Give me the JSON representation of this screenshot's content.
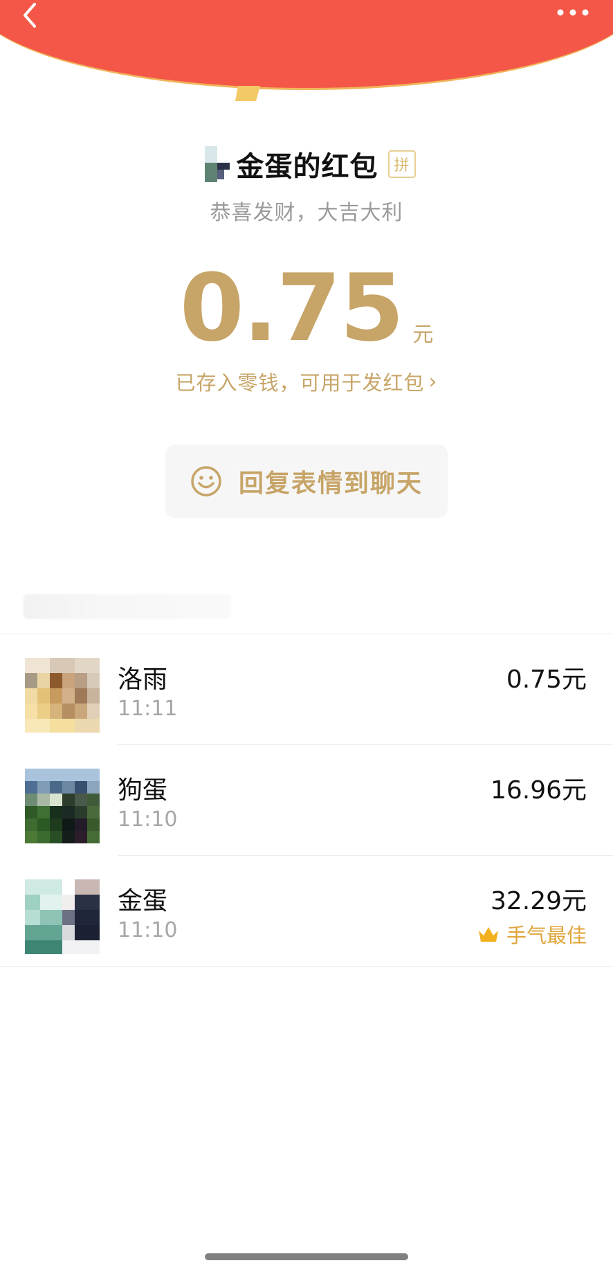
{
  "header": {
    "back_icon": "chevron-left-icon",
    "more_icon": "more-dots-icon",
    "accent_color": "#f45748"
  },
  "sender": {
    "title": "金蛋的红包",
    "badge": "拼",
    "wish": "恭喜发财，大吉大利"
  },
  "amount": {
    "value": "0.75",
    "unit": "元",
    "stored_text": "已存入零钱，可用于发红包",
    "chevron": "›",
    "color": "#c7a467"
  },
  "reply_button": {
    "icon": "smile-icon",
    "label": "回复表情到聊天"
  },
  "records": [
    {
      "name": "洛雨",
      "time": "11:11",
      "amount": "0.75元"
    },
    {
      "name": "狗蛋",
      "time": "11:10",
      "amount": "16.96元"
    },
    {
      "name": "金蛋",
      "time": "11:10",
      "amount": "32.29元",
      "best_label": "手气最佳",
      "best_icon": "crown-icon"
    }
  ]
}
